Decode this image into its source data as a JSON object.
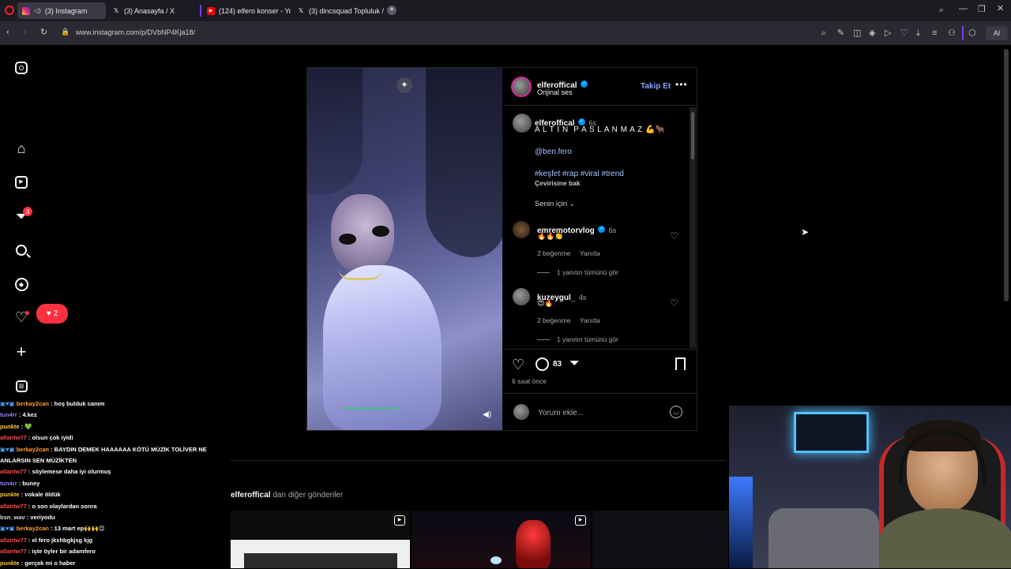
{
  "browser": {
    "tabs": [
      {
        "label": "(3) Instagram",
        "active": true,
        "icon": "instagram-icon"
      },
      {
        "label": "(3) Anasayfa / X",
        "active": false,
        "icon": "x-icon"
      },
      {
        "label": "(124) elfero konser - YouT",
        "active": false,
        "icon": "youtube-icon"
      },
      {
        "label": "(3) dincsquad Topluluk / X",
        "active": false,
        "icon": "x-icon"
      }
    ],
    "url": "www.instagram.com/p/DVbNP4Kja18/",
    "ai_label": "AI"
  },
  "sidebar": {
    "notifications_badge": "3",
    "likes_popup_count": "2"
  },
  "post": {
    "username": "elferoffical",
    "audio": "Orijinal ses",
    "follow_label": "Takip Et",
    "caption_time": "6s",
    "caption": "A L T I N  P A S L A N M A Z 💪🐂",
    "mention": "@ben.fero",
    "hashtags": "#keşfet #rap #viral #trend",
    "translate_label": "Çevirisine bak",
    "sort_label": "Senin için",
    "comments": [
      {
        "user": "emremotorvlog",
        "verified": true,
        "time": "6s",
        "text": "🔥🔥👏",
        "likes": "2 beğenme",
        "reply": "Yanıtla",
        "view_replies": "1 yanıtın tümünü gör"
      },
      {
        "user": "kuzeygul_",
        "verified": false,
        "time": "4s",
        "text": "😍🔥",
        "likes": "2 beğenme",
        "reply": "Yanıtla",
        "view_replies": "1 yanıtın tümünü gör"
      }
    ],
    "comment_count": "83",
    "posted_ago": "6 saat önce",
    "comment_placeholder": "Yorum ekle..."
  },
  "more_posts": {
    "username": "elferoffical",
    "suffix": " dan diğer gönderiler"
  },
  "chat": [
    {
      "user": "berkay2can",
      "color": "#ff9f3a",
      "badges": true,
      "text": ": hoş bulduk canım"
    },
    {
      "user": "tun4rr",
      "color": "#9b7bff",
      "badges": false,
      "text": ": 4.kez"
    },
    {
      "user": "punkte",
      "color": "#ffcc33",
      "badges": false,
      "text": ": 💚"
    },
    {
      "user": "allantw77",
      "color": "#ff4a4a",
      "badges": false,
      "text": ": olsun çok iyidi"
    },
    {
      "user": "berkay2can",
      "color": "#ff9f3a",
      "badges": true,
      "text": ": BAYDIN DEMEK HAAAAAA KÖTÜ MÜZİK TOLİVER NE"
    },
    {
      "user": "",
      "color": "#ffffff",
      "badges": false,
      "text": "ANLARSIN SEN MÜZİKTEN"
    },
    {
      "user": "allantw77",
      "color": "#ff4a4a",
      "badges": false,
      "text": ": söylemese daha iyi olurmuş"
    },
    {
      "user": "tun4rr",
      "color": "#9b7bff",
      "badges": false,
      "text": ": buney"
    },
    {
      "user": "punkte",
      "color": "#ffcc33",
      "badges": false,
      "text": ": vokale öldük"
    },
    {
      "user": "allantw77",
      "color": "#ff4a4a",
      "badges": false,
      "text": ": o son olaylardan sonra"
    },
    {
      "user": "bsn_wav",
      "color": "#dddddd",
      "badges": false,
      "text": ": veriyodu"
    },
    {
      "user": "berkay2can",
      "color": "#ff9f3a",
      "badges": true,
      "text": ": 13 mart ep🙌🙌😊"
    },
    {
      "user": "allantw77",
      "color": "#ff4a4a",
      "badges": false,
      "text": ": el fero jkshbgkjsg kjg"
    },
    {
      "user": "allantw77",
      "color": "#ff4a4a",
      "badges": false,
      "text": ": işte öyler bir adamfero"
    },
    {
      "user": "punkte",
      "color": "#ffcc33",
      "badges": false,
      "text": ": gerçek mi o haber"
    }
  ]
}
